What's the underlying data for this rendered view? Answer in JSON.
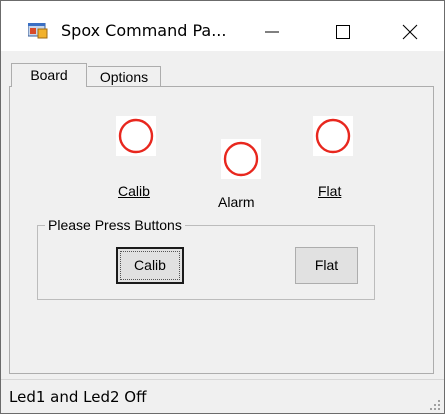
{
  "window": {
    "title": "Spox Command Pa...",
    "icons": {
      "app": "app-window-icon",
      "minimize": "minimize-icon",
      "maximize": "maximize-icon",
      "close": "close-icon"
    }
  },
  "tabs": [
    {
      "label": "Board",
      "selected": true
    },
    {
      "label": "Options",
      "selected": false
    }
  ],
  "leds": [
    {
      "label": "Calib",
      "state": "off",
      "color": "#e8271e"
    },
    {
      "label": "Alarm",
      "state": "off",
      "color": "#e8271e"
    },
    {
      "label": "Flat",
      "state": "off",
      "color": "#e8271e"
    }
  ],
  "group": {
    "title": "Please Press Buttons",
    "buttons": [
      {
        "label": "Calib",
        "focused": true
      },
      {
        "label": "Flat",
        "focused": false
      }
    ]
  },
  "status": {
    "text": "Led1 and Led2 Off",
    "grip_icon": "resize-grip-icon"
  }
}
